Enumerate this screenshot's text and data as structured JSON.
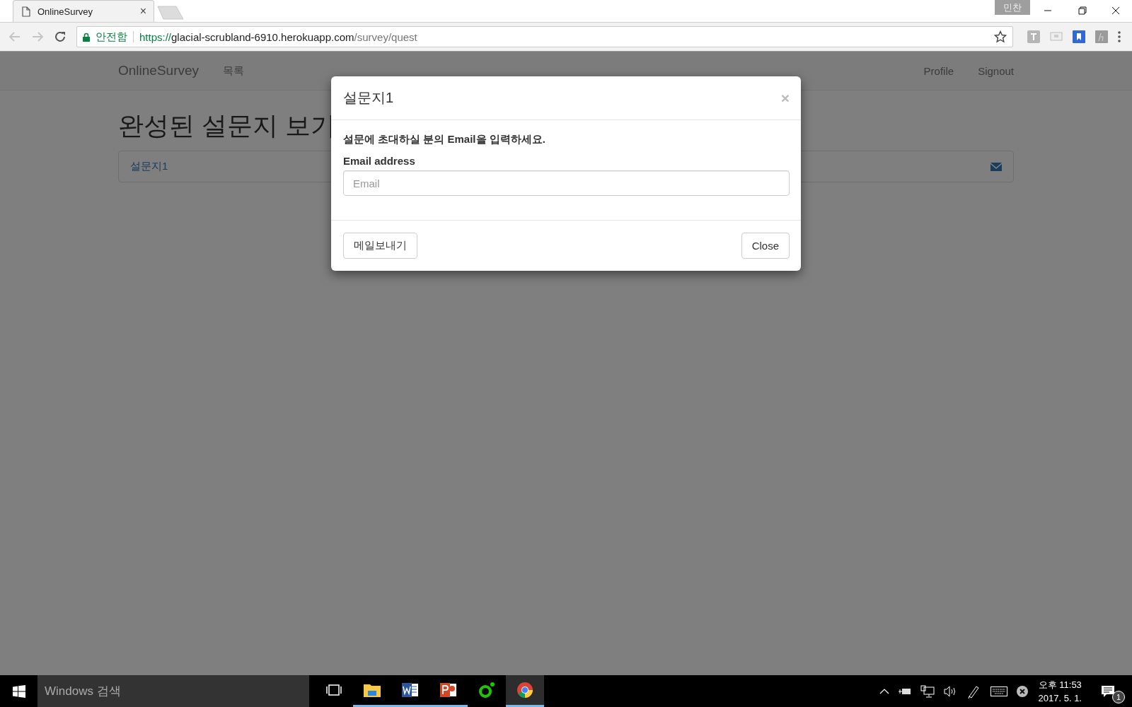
{
  "browser": {
    "tab": {
      "title": "OnlineSurvey",
      "close": "×"
    },
    "profile_name": "민찬",
    "address_bar": {
      "security_label": "안전함",
      "url_scheme": "https://",
      "url_host": "glacial-scrubland-6910.herokuapp.com",
      "url_path": "/survey/quest"
    }
  },
  "navbar": {
    "brand": "OnlineSurvey",
    "links": [
      {
        "label": "목록"
      }
    ],
    "right_links": [
      {
        "label": "Profile"
      },
      {
        "label": "Signout"
      }
    ]
  },
  "page": {
    "heading": "완성된 설문지 보기",
    "surveys": [
      {
        "title": "설문지1"
      }
    ]
  },
  "modal": {
    "title": "설문지1",
    "close": "×",
    "instruction": "설문에 초대하실 분의 Email을 입력하세요.",
    "email_label": "Email address",
    "email_field": {
      "placeholder": "Email"
    },
    "buttons": [
      {
        "label": "메일보내기"
      },
      {
        "label": "Close"
      }
    ]
  },
  "taskbar": {
    "search": {
      "placeholder": "Windows 검색"
    },
    "apps": [
      {
        "kind": "task-view",
        "running": false,
        "active": false
      },
      {
        "kind": "explorer",
        "running": true,
        "active": false
      },
      {
        "kind": "word",
        "running": true,
        "active": false
      },
      {
        "kind": "powerpoint",
        "running": true,
        "active": false
      },
      {
        "kind": "green-app",
        "running": false,
        "active": false
      },
      {
        "kind": "chrome",
        "running": true,
        "active": true
      }
    ],
    "clock": {
      "time": "오후 11:53",
      "date": "2017. 5. 1."
    },
    "notification_count": "1"
  }
}
